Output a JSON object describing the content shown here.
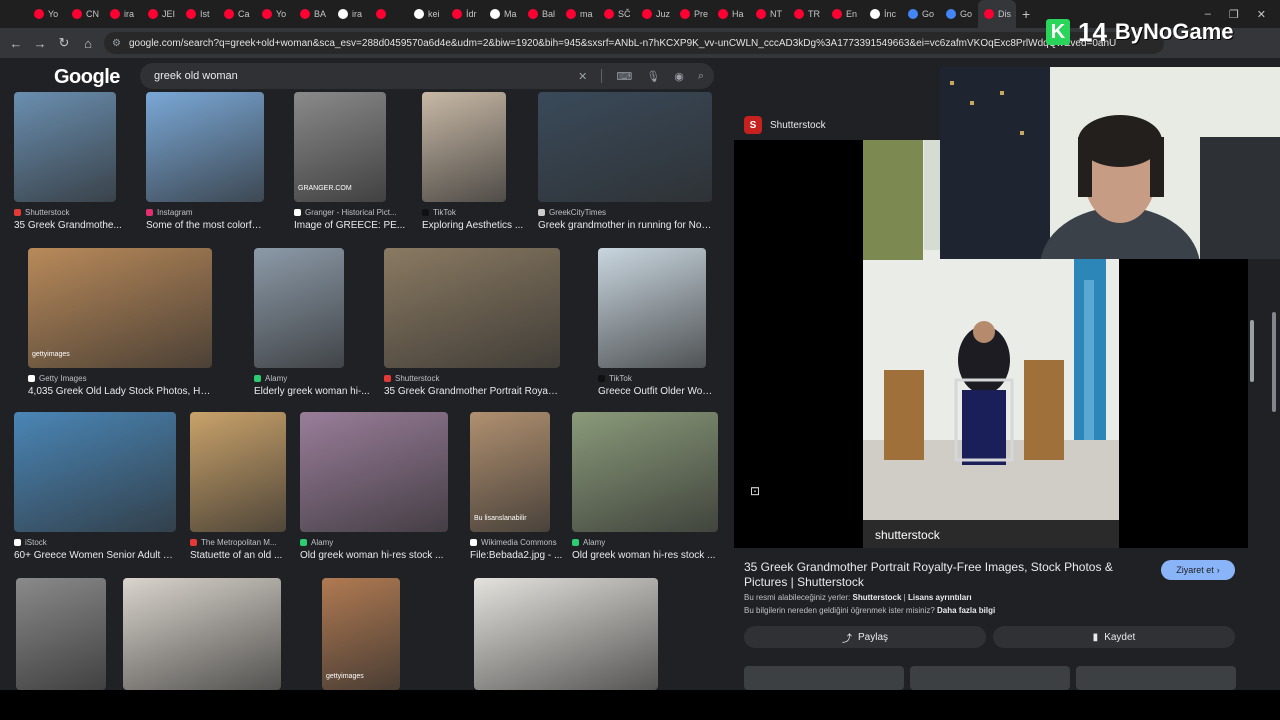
{
  "browser": {
    "tabs": [
      {
        "label": "Yo",
        "color": "#ff0033"
      },
      {
        "label": "CN",
        "color": "#ff0033"
      },
      {
        "label": "ira",
        "color": "#ff0033"
      },
      {
        "label": "JEI",
        "color": "#ff0033"
      },
      {
        "label": "Ist",
        "color": "#ff0033"
      },
      {
        "label": "Ca",
        "color": "#ff0033"
      },
      {
        "label": "Yo",
        "color": "#ff0033"
      },
      {
        "label": "BA",
        "color": "#ff0033"
      },
      {
        "label": "ira",
        "color": "#ffffff"
      },
      {
        "label": "",
        "color": "#ff0033"
      },
      {
        "label": "kei",
        "color": "#ffffff"
      },
      {
        "label": "İdr",
        "color": "#ff0033"
      },
      {
        "label": "Ma",
        "color": "#ffffff"
      },
      {
        "label": "Bal",
        "color": "#ff0033"
      },
      {
        "label": "ma",
        "color": "#ff0033"
      },
      {
        "label": "SČ",
        "color": "#ff0033"
      },
      {
        "label": "Juz",
        "color": "#ff0033"
      },
      {
        "label": "Pre",
        "color": "#ff0033"
      },
      {
        "label": "Ha",
        "color": "#ff0033"
      },
      {
        "label": "NT",
        "color": "#ff0033"
      },
      {
        "label": "TR",
        "color": "#ff0033"
      },
      {
        "label": "En",
        "color": "#ff0033"
      },
      {
        "label": "İnc",
        "color": "#ffffff"
      },
      {
        "label": "Go",
        "color": "#4285f4"
      },
      {
        "label": "Go",
        "color": "#4285f4"
      },
      {
        "label": "Dis",
        "color": "#ff0033"
      }
    ],
    "active_tab_close": "×",
    "new_tab": "+",
    "url": "google.com/search?q=greek+old+woman&sca_esv=288d0459570a6d4e&udm=2&biw=1920&bih=945&sxsrf=ANbL-n7hKCXP9K_vv-unCWLN_cccAD3kDg%3A1773391549663&ei=vc6zafmVKOqExc8PrlWdqQw&ved=0ahU"
  },
  "google": {
    "logo": "Google",
    "query": "greek old woman"
  },
  "results": [
    {
      "source": "Shutterstock",
      "title": "35 Greek Grandmothe...",
      "icon_color": "#e53935"
    },
    {
      "source": "Instagram",
      "title": "Some of the most colorful s...",
      "icon_color": "#e1306c"
    },
    {
      "source": "Granger - Historical Pict...",
      "title": "Image of GREECE: PE...",
      "icon_color": "#ffffff"
    },
    {
      "source": "TikTok",
      "title": "Exploring Aesthetics ...",
      "icon_color": "#111111"
    },
    {
      "source": "GreekCityTimes",
      "title": "Greek grandmother in running for Nobel ...",
      "icon_color": "#cccccc"
    },
    {
      "source": "Getty Images",
      "title": "4,035 Greek Old Lady Stock Photos, High-Re...",
      "icon_color": "#ffffff"
    },
    {
      "source": "Alamy",
      "title": "Elderly greek woman hi-...",
      "icon_color": "#2ecc71"
    },
    {
      "source": "Shutterstock",
      "title": "35 Greek Grandmother Portrait Royalty-Fre...",
      "icon_color": "#e53935"
    },
    {
      "source": "TikTok",
      "title": "Greece Outfit Older Wome...",
      "icon_color": "#111111"
    },
    {
      "source": "iStock",
      "title": "60+ Greece Women Senior Adult T...",
      "icon_color": "#ffffff"
    },
    {
      "source": "The Metropolitan M...",
      "title": "Statuette of an old ...",
      "icon_color": "#e53935"
    },
    {
      "source": "Alamy",
      "title": "Old greek woman hi-res stock ...",
      "icon_color": "#2ecc71"
    },
    {
      "source": "Wikimedia Commons",
      "title": "File:Bebada2.jpg - ...",
      "icon_color": "#ffffff"
    },
    {
      "source": "Alamy",
      "title": "Old greek woman hi-res stock ...",
      "icon_color": "#2ecc71"
    },
    {
      "source": "",
      "title": "",
      "icon_color": "#ffffff"
    },
    {
      "source": "",
      "title": "",
      "icon_color": "#ffffff"
    },
    {
      "source": "",
      "title": "",
      "icon_color": "#ffffff"
    },
    {
      "source": "",
      "title": "",
      "icon_color": "#ffffff"
    }
  ],
  "overlay_text": {
    "thumb_watermark_1": "GRANGER.COM",
    "thumb_watermark_2": "gettyimages",
    "thumb_watermark_3": "Bu lisanslanabilir",
    "preview_watermark": "shutterstock"
  },
  "preview": {
    "source": "Shutterstock",
    "logo_letter": "S",
    "title": "35 Greek Grandmother Portrait Royalty-Free Images, Stock Photos & Pictures | Shutterstock",
    "visit_label": "Ziyaret et",
    "license_prefix": "Bu resmi alabileceğiniz yerler:",
    "license_source": "Shutterstock",
    "license_sep": "|",
    "license_link": "Lisans ayrıntıları",
    "info_text": "Bu bilgilerin nereden geldiğini öğrenmek ister misiniz?",
    "info_link": "Daha fazla bilgi",
    "share_label": "Paylaş",
    "save_label": "Kaydet"
  },
  "brand": {
    "k_letter": "K",
    "number": "14",
    "name": "ByNoGame"
  }
}
